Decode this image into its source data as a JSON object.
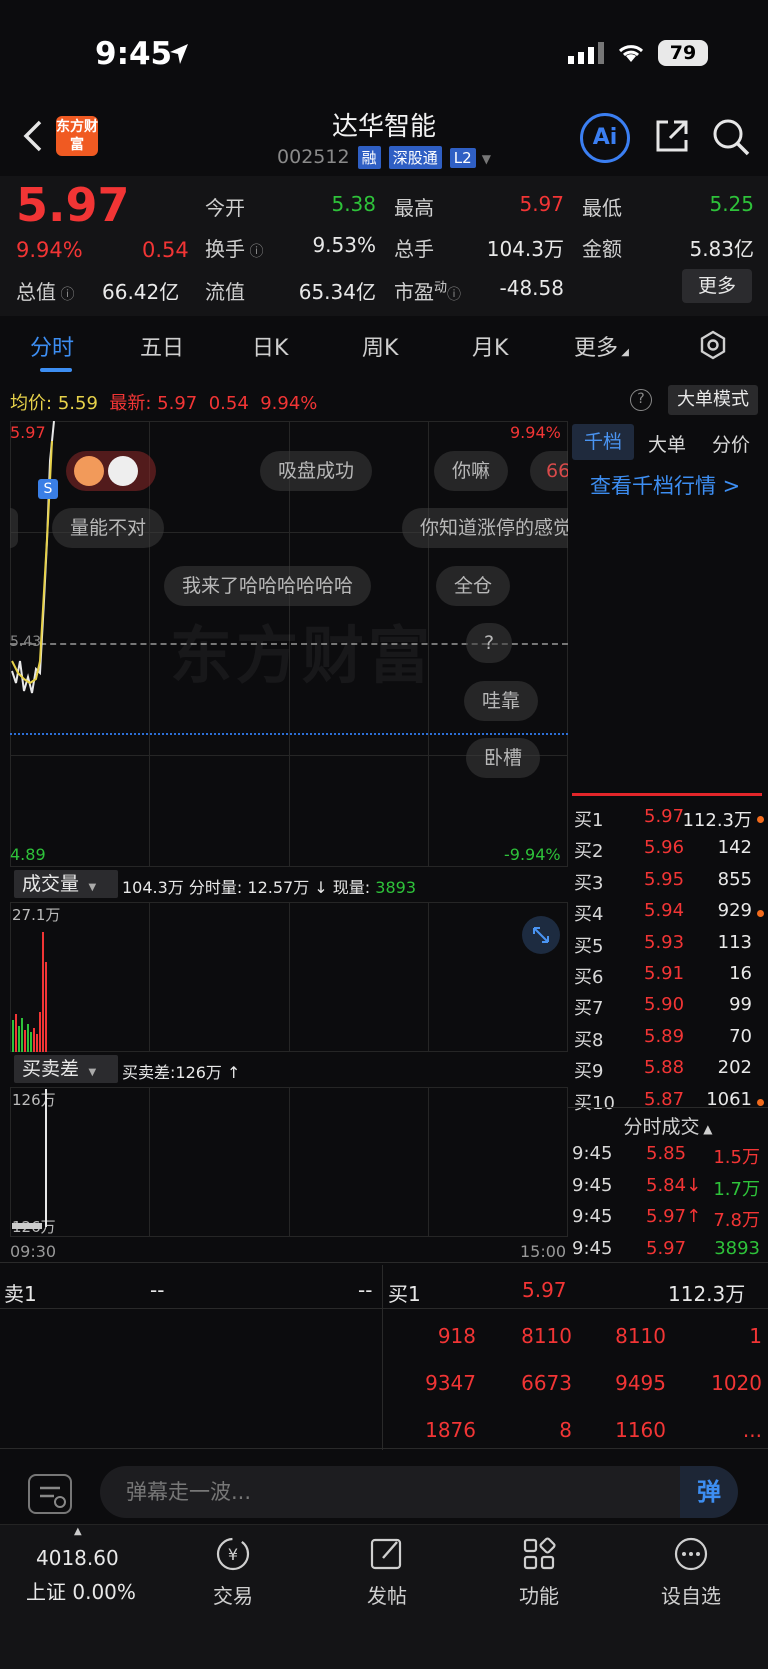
{
  "status": {
    "time": "9:45",
    "battery": "79"
  },
  "header": {
    "logo": "东方财富",
    "name": "达华智能",
    "code": "002512",
    "tags": [
      "融",
      "深股通",
      "L2"
    ],
    "ai_label": "Ai"
  },
  "quote": {
    "price": "5.97",
    "change_pct": "9.94%",
    "change_val": "0.54",
    "total_cap_label": "总值",
    "total_cap": "66.42亿",
    "open_label": "今开",
    "open": "5.38",
    "high_label": "最高",
    "high": "5.97",
    "low_label": "最低",
    "low": "5.25",
    "turnover_label": "换手",
    "turnover": "9.53%",
    "volume_label": "总手",
    "volume": "104.3万",
    "amount_label": "金额",
    "amount": "5.83亿",
    "float_cap_label": "流值",
    "float_cap": "65.34亿",
    "pe_label": "市盈",
    "pe_sup": "动",
    "pe": "-48.58",
    "more_label": "更多"
  },
  "tabs": [
    "分时",
    "五日",
    "日K",
    "周K",
    "月K",
    "更多"
  ],
  "info_line": {
    "avg_label": "均价:",
    "avg": "5.59",
    "latest_label": "最新:",
    "latest": "5.97",
    "latest_chg": "0.54",
    "latest_pct": "9.94%",
    "big_mode": "大单模式"
  },
  "chart": {
    "top_price": "5.97",
    "top_pct": "9.94%",
    "bottom_price": "4.89",
    "bottom_pct": "-9.94%",
    "mid_label": "5.43",
    "watermark": "东方财富",
    "start_time": "09:30",
    "end_time": "15:00"
  },
  "bullets": [
    {
      "text": "吸盘成功"
    },
    {
      "text": "你嘛"
    },
    {
      "text": "66"
    },
    {
      "text": "量能不对"
    },
    {
      "text": "你知道涨停的感觉"
    },
    {
      "text": "我来了哈哈哈哈哈哈"
    },
    {
      "text": "全仓"
    },
    {
      "text": "?"
    },
    {
      "text": "哇靠"
    },
    {
      "text": "卧槽"
    }
  ],
  "volume": {
    "label": "成交量",
    "total": "104.3万",
    "minute_label": "分时量:",
    "minute": "12.57万",
    "now_label": "现量:",
    "now": "3893",
    "max": "27.1万"
  },
  "diff": {
    "label": "买卖差",
    "info": "买卖差:126万 ↑",
    "max": "126万",
    "min": "126万"
  },
  "right_panel": {
    "tabs": [
      "千档",
      "大单",
      "分价"
    ],
    "link": "查看千档行情 >",
    "bids": [
      {
        "label": "买1",
        "price": "5.97",
        "vol": "112.3万",
        "dot": true
      },
      {
        "label": "买2",
        "price": "5.96",
        "vol": "142",
        "dot": false
      },
      {
        "label": "买3",
        "price": "5.95",
        "vol": "855",
        "dot": false
      },
      {
        "label": "买4",
        "price": "5.94",
        "vol": "929",
        "dot": true
      },
      {
        "label": "买5",
        "price": "5.93",
        "vol": "113",
        "dot": false
      },
      {
        "label": "买6",
        "price": "5.91",
        "vol": "16",
        "dot": false
      },
      {
        "label": "买7",
        "price": "5.90",
        "vol": "99",
        "dot": false
      },
      {
        "label": "买8",
        "price": "5.89",
        "vol": "70",
        "dot": false
      },
      {
        "label": "买9",
        "price": "5.88",
        "vol": "202",
        "dot": false
      },
      {
        "label": "买10",
        "price": "5.87",
        "vol": "1061",
        "dot": true
      }
    ],
    "trade_title": "分时成交",
    "trades": [
      {
        "time": "9:45",
        "price": "5.85",
        "vol": "1.5万",
        "vol_color": "#f23535"
      },
      {
        "time": "9:45",
        "price": "5.84↓",
        "vol": "1.7万",
        "vol_color": "#2ec23a"
      },
      {
        "time": "9:45",
        "price": "5.97↑",
        "vol": "7.8万",
        "vol_color": "#f23535"
      },
      {
        "time": "9:45",
        "price": "5.97",
        "vol": "3893",
        "vol_color": "#2ec23a"
      }
    ]
  },
  "orderbook": {
    "sell1_label": "卖1",
    "sell1_price": "--",
    "sell1_vol": "--",
    "buy1_label": "买1",
    "buy1_price": "5.97",
    "buy1_vol": "112.3万",
    "queue": [
      [
        "918",
        "8110",
        "8110",
        "1"
      ],
      [
        "9347",
        "6673",
        "9495",
        "1020"
      ],
      [
        "1876",
        "8",
        "1160",
        "..."
      ]
    ]
  },
  "danmaku": {
    "placeholder": "弹幕走一波...",
    "send": "弹"
  },
  "nav": {
    "index_value": "4018.60",
    "index_label": "上证  0.00%",
    "items": [
      "交易",
      "发帖",
      "功能",
      "设自选"
    ]
  }
}
